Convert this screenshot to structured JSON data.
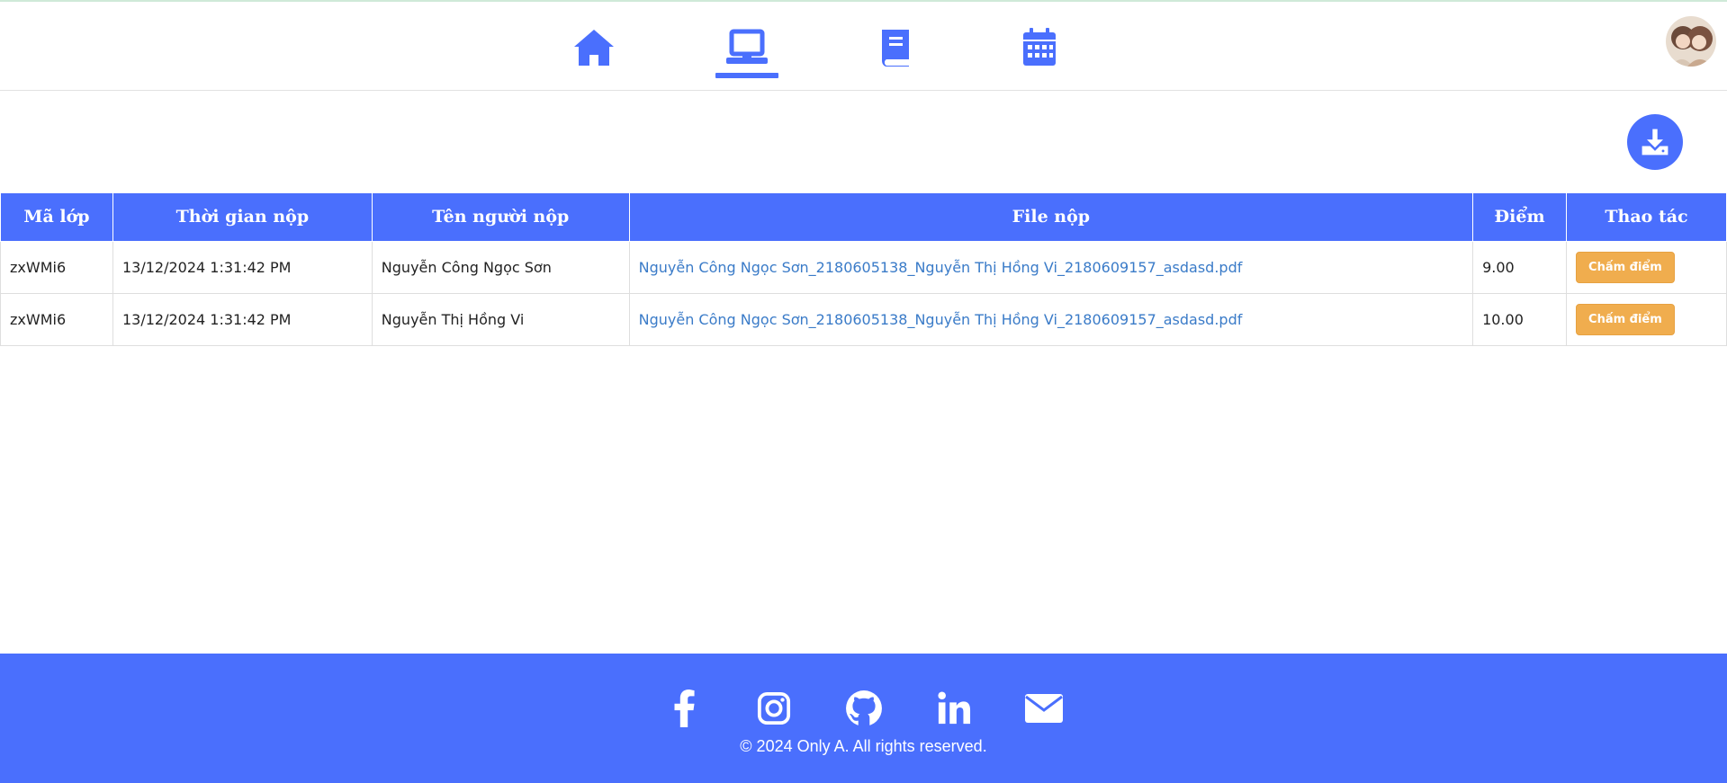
{
  "nav": {
    "icons": [
      "home-icon",
      "laptop-icon",
      "book-icon",
      "calendar-icon"
    ],
    "active": "laptop-icon"
  },
  "colors": {
    "primary": "#4a6ffd",
    "grade_button": "#f0ad4e",
    "link": "#3a7bc8"
  },
  "table": {
    "headers": [
      "Mã lớp",
      "Thời gian nộp",
      "Tên người nộp",
      "File nộp",
      "Điểm",
      "Thao tác"
    ],
    "rows": [
      {
        "class_code": "zxWMi6",
        "submitted_at": "13/12/2024 1:31:42 PM",
        "submitter": "Nguyễn Công Ngọc Sơn",
        "file": "Nguyễn Công Ngọc Sơn_2180605138_Nguyễn Thị Hồng Vi_2180609157_asdasd.pdf",
        "score": "9.00",
        "action": "Chấm điểm"
      },
      {
        "class_code": "zxWMi6",
        "submitted_at": "13/12/2024 1:31:42 PM",
        "submitter": "Nguyễn Thị Hồng Vi",
        "file": "Nguyễn Công Ngọc Sơn_2180605138_Nguyễn Thị Hồng Vi_2180609157_asdasd.pdf",
        "score": "10.00",
        "action": "Chấm điểm"
      }
    ]
  },
  "footer": {
    "social_icons": [
      "facebook-icon",
      "instagram-icon",
      "github-icon",
      "linkedin-icon",
      "email-icon"
    ],
    "copyright": "© 2024 Only A. All rights reserved."
  }
}
